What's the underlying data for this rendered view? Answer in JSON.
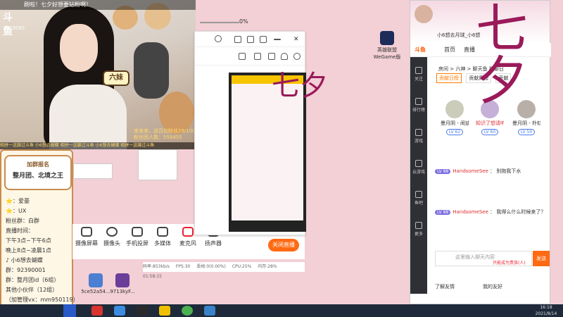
{
  "stream": {
    "logo": "斗鱼",
    "top_banner": "刷啦！七夕好想要钻粉啊！",
    "room_id": "7623092",
    "badge": "六妹",
    "volume_label": "0%",
    "stats_lines": [
      "来来来，送百钻粉丝29/100",
      "粉丝团人数：55945S"
    ],
    "ticker": "相拼一送腺过斗鱼 小6想去蝴蝶 相拼一送腺过斗鱼 小6想去蝴蝶 相拼一送腺过斗鱼"
  },
  "info_panel": {
    "join_title": "加群报名",
    "join_sub": "整月团、北境之王",
    "lines": [
      "⭐：爱豪",
      "⭐：UX",
      "粉丝群：白群",
      "直播时间：",
      "下午3点~下午6点",
      "晚上8点~凌晨1点",
      "♪ 小6想去蝴蝶",
      "群：92390001",
      "群：整月团id（6组）",
      "其他小伙伴（12组）",
      "（加管理vx：mm950119）"
    ]
  },
  "obs": {
    "tools": [
      "摄像屏幕",
      "摄像头",
      "手机投屏",
      "多媒体",
      "麦克风",
      "扬声器"
    ],
    "start_label": "关闭直播",
    "status": [
      "码率:853kb/s",
      "FPS:30",
      "丢帧:0(0.00%)",
      "CPU:25%",
      "内存:28%",
      "01:58:15"
    ]
  },
  "desktop_icons": [
    {
      "label": "英雄联盟\nWeGame版",
      "color": "#1d2c58"
    },
    {
      "label": "5ce52a54...",
      "color": "#4a7fd1"
    },
    {
      "label": "9713kyF...",
      "color": "#6b3e9a"
    }
  ],
  "chat": {
    "title": "小6想去月球_小6想",
    "nav": [
      "首页",
      "直播"
    ],
    "breadcrumb": "房间 > 六神 > 聊天鱼 相聊日",
    "rank_tabs": [
      "贡献日榜",
      "贡献周榜",
      "贡献"
    ],
    "rank_users": [
      {
        "name": "曼月阴 - 闹迪AI...",
        "level": "LV 62"
      },
      {
        "name": "知识了想请听",
        "level": "LV 60"
      },
      {
        "name": "曼月阴 - 朴虹",
        "level": "LV 50"
      }
    ],
    "messages": [
      {
        "level": "LV 88",
        "user": "HandsomeSee",
        "text": "别拖我下水"
      },
      {
        "level": "LV 88",
        "user": "HandsomeSee",
        "text": "我得么什么时候来了？"
      }
    ],
    "input_placeholder": "这里输入聊天内容",
    "send_label": "发送",
    "gift_hint": "只能成为贵族(人)",
    "fans_label": "我的友好",
    "friends_label": "了解友情",
    "side_items": [
      "关注",
      "排行榜",
      "游戏",
      "云游戏",
      "鱼吧",
      "更多"
    ],
    "qixi": "七夕"
  },
  "taskbar": {
    "time": "16:18",
    "date": "2021/8/14"
  }
}
